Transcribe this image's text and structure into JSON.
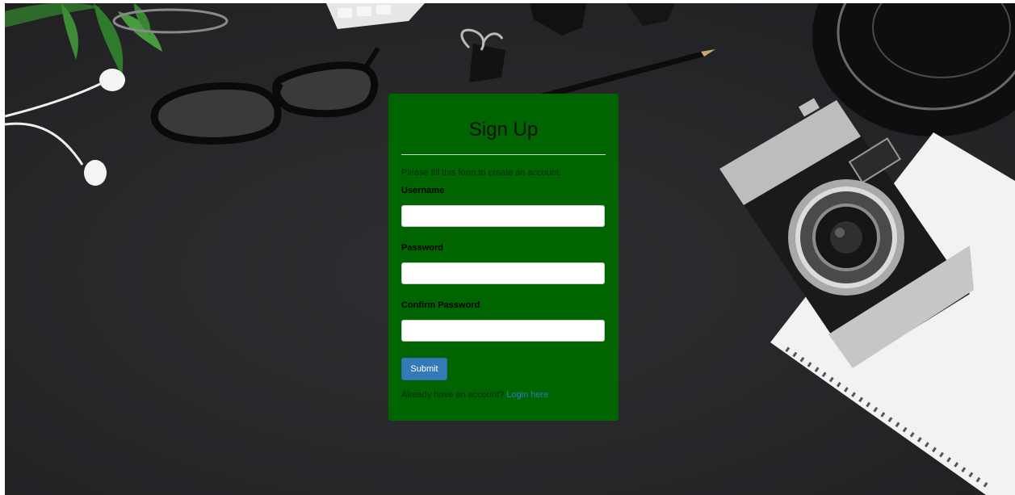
{
  "form": {
    "title": "Sign Up",
    "intro": "Please fill this form to create an account.",
    "fields": [
      {
        "label": "Username",
        "value": "",
        "placeholder": ""
      },
      {
        "label": "Password",
        "value": "",
        "placeholder": ""
      },
      {
        "label": "Confirm Password",
        "value": "",
        "placeholder": ""
      }
    ],
    "submit_label": "Submit",
    "footer_text": "Already have an account?",
    "login_link": "Login here"
  },
  "colors": {
    "card_background": "#006400",
    "submit_button": "#337ab7",
    "link": "#337ab7",
    "page_background": "#2b2b2e"
  },
  "background_objects": [
    "plant-leaves",
    "earphones",
    "eyeglasses",
    "keyboard",
    "binder-clips",
    "pencil",
    "camera",
    "spiral-notebook",
    "mug"
  ]
}
